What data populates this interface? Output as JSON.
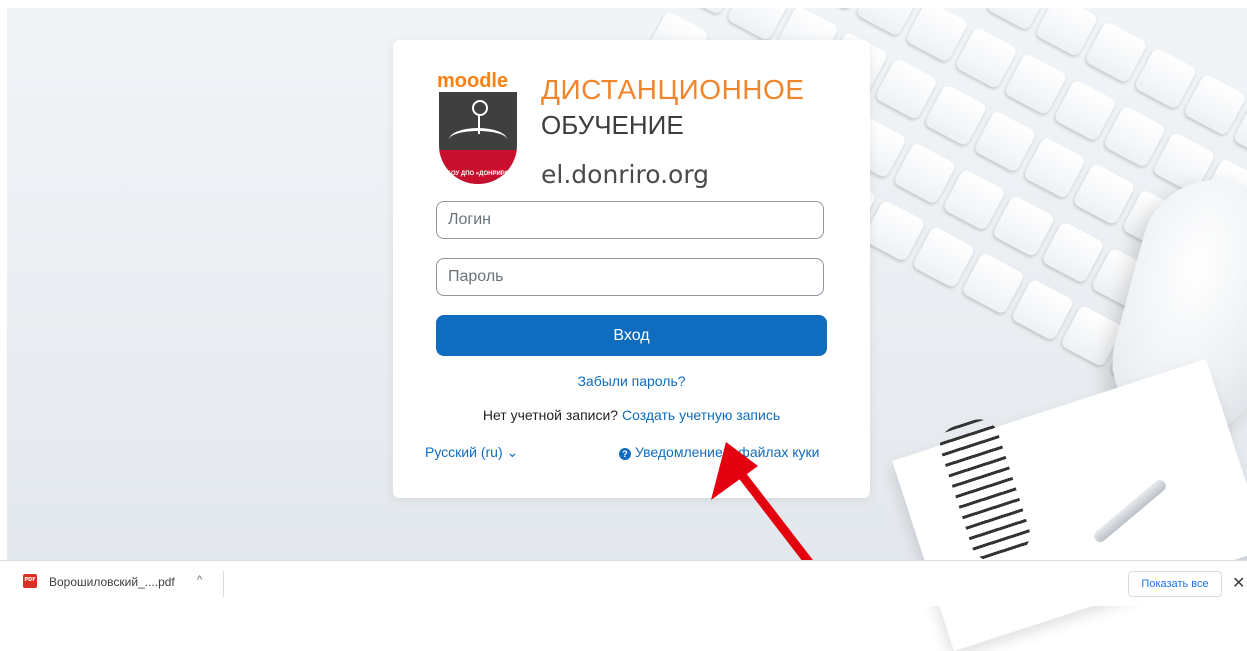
{
  "brand": {
    "logo_text": "moodle",
    "logo_badge_text": "ГБОУ ДПО «ДОНРИРО»",
    "title_line1": "ДИСТАНЦИОННОЕ",
    "title_line2": "ОБУЧЕНИЕ",
    "site": "el.donriro.org"
  },
  "login_form": {
    "username_placeholder": "Логин",
    "password_placeholder": "Пароль",
    "submit_label": "Вход",
    "forgot_link": "Забыли пароль?",
    "no_account_text": "Нет учетной записи?",
    "signup_link": "Создать учетную запись"
  },
  "footer": {
    "language": "Русский (ru)",
    "language_chevron": "⌄",
    "cookie_notice": "Уведомление о файлах куки"
  },
  "download_bar": {
    "file_name": "Ворошиловский_....pdf",
    "chevron": "^",
    "show_all_label": "Показать все",
    "close_symbol": "✕"
  },
  "colors": {
    "primary": "#0f6cbf",
    "brand_orange": "#f0862b",
    "arrow_red": "#e3000f"
  }
}
